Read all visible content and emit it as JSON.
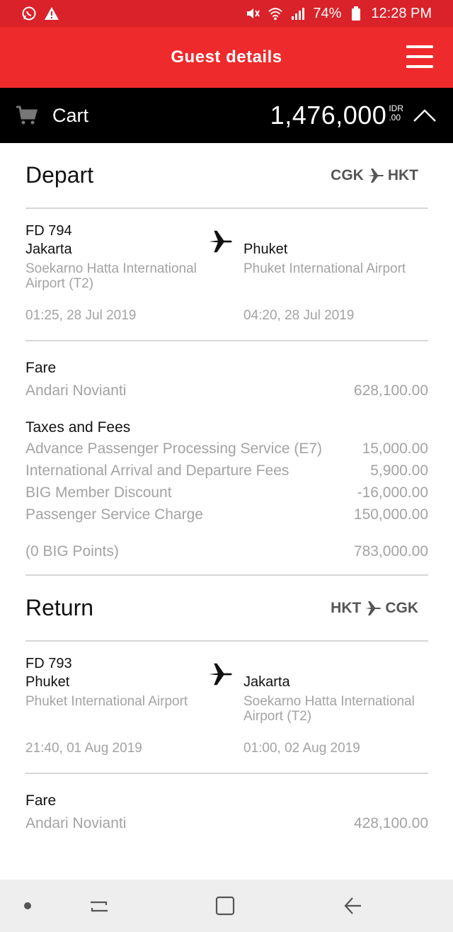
{
  "status_bar": {
    "battery": "74%",
    "time": "12:28 PM"
  },
  "header": {
    "title": "Guest details"
  },
  "cart": {
    "label": "Cart",
    "amount": "1,476,000",
    "currency": "IDR",
    "decimals": ".00"
  },
  "depart": {
    "title": "Depart",
    "route_from": "CGK",
    "route_to": "HKT",
    "flight_no": "FD 794",
    "from_city": "Jakarta",
    "from_airport": "Soekarno Hatta International Airport (T2)",
    "from_time": "01:25, 28 Jul 2019",
    "to_city": "Phuket",
    "to_airport": "Phuket International Airport",
    "to_time": "04:20, 28 Jul 2019",
    "fare_label": "Fare",
    "passenger": "Andari Novianti",
    "fare_amount": "628,100.00",
    "taxes_label": "Taxes and Fees",
    "taxes": [
      {
        "label": "Advance Passenger Processing Service (E7)",
        "amount": "15,000.00"
      },
      {
        "label": "International Arrival and Departure Fees",
        "amount": "5,900.00"
      },
      {
        "label": "BIG Member Discount",
        "amount": "-16,000.00"
      },
      {
        "label": "Passenger Service Charge",
        "amount": "150,000.00"
      }
    ],
    "points_label": "(0 BIG Points)",
    "total": "783,000.00"
  },
  "return": {
    "title": "Return",
    "route_from": "HKT",
    "route_to": "CGK",
    "flight_no": "FD 793",
    "from_city": "Phuket",
    "from_airport": "Phuket International Airport",
    "from_time": "21:40, 01 Aug 2019",
    "to_city": "Jakarta",
    "to_airport": "Soekarno Hatta International Airport (T2)",
    "to_time": "01:00, 02 Aug 2019",
    "fare_label": "Fare",
    "passenger": "Andari Novianti",
    "fare_amount": "428,100.00"
  },
  "colors": {
    "status_bar": "#d9222a",
    "app_bar": "#ee2a2c",
    "cart_bar": "#000000",
    "muted_text": "#a3a3a3",
    "nav_bar": "#eeeeee"
  }
}
